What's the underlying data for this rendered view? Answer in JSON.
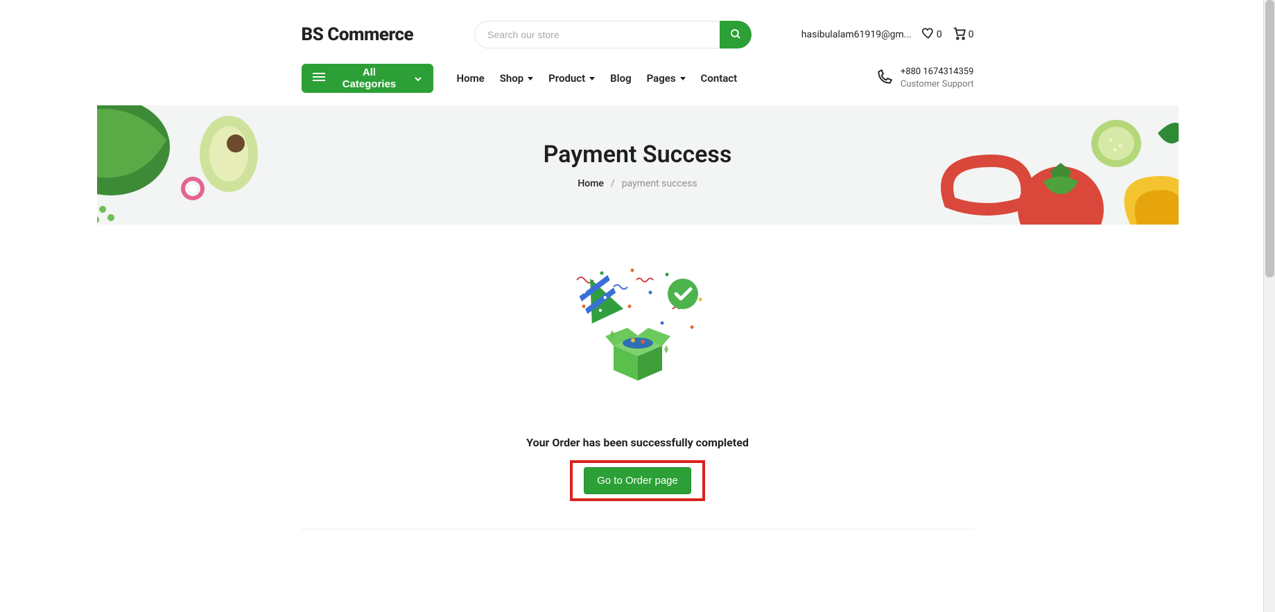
{
  "header": {
    "logo": "BS Commerce",
    "search_placeholder": "Search our store",
    "user_email": "hasibulalam61919@gm...",
    "wishlist_count": "0",
    "cart_count": "0",
    "categories_label": "All Categories",
    "nav": {
      "home": "Home",
      "shop": "Shop",
      "product": "Product",
      "blog": "Blog",
      "pages": "Pages",
      "contact": "Contact"
    },
    "support": {
      "phone": "+880 1674314359",
      "label": "Customer Support"
    }
  },
  "hero": {
    "title": "Payment Success",
    "crumb_home": "Home",
    "crumb_sep": "/",
    "crumb_current": "payment success"
  },
  "main": {
    "message": "Your Order has been successfully completed",
    "cta_label": "Go to Order page"
  },
  "colors": {
    "accent": "#2ca037",
    "highlight_box": "#d9221b"
  }
}
